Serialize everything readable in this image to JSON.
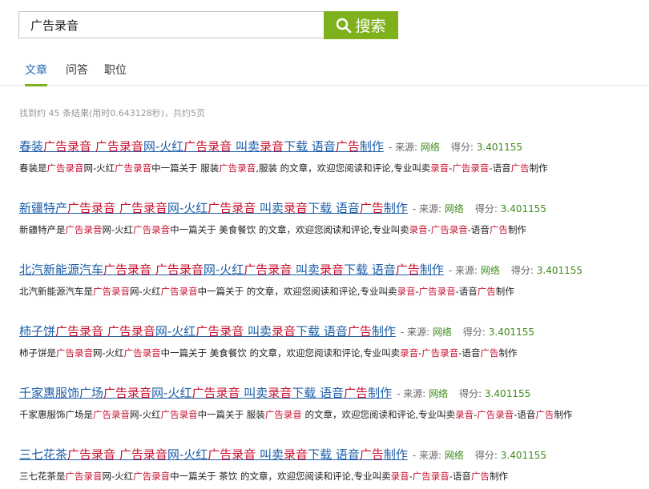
{
  "search": {
    "value": "广告录音",
    "button_label": "搜索"
  },
  "tabs": [
    {
      "label": "文章",
      "active": true
    },
    {
      "label": "问答",
      "active": false
    },
    {
      "label": "职位",
      "active": false
    }
  ],
  "stats": "找到约 45 条结果(用时0.643128秒)，共约5页",
  "colors": {
    "accent": "#7fb11d",
    "link": "#1d5ea8",
    "highlight": "#c8102e",
    "source": "#3c8c1a"
  },
  "labels": {
    "source": "来源:",
    "score": "得分:",
    "separator": "-"
  },
  "results": [
    {
      "title_prefix": "春装",
      "title_rest": "广告录音 广告录音网-火红广告录音 叫卖录音下载 语音广告制作",
      "source": "网络",
      "score": "3.401155",
      "snippet_name": "春装",
      "snippet_topic": "服装广告录音,服装",
      "snippet_body": "是广告录音网-火红广告录音中一篇关于 服装广告录音,服装 的文章，欢迎您阅读和评论,专业叫卖录音-广告录音-语音广告制作"
    },
    {
      "title_prefix": "新疆特产",
      "title_rest": "广告录音 广告录音网-火红广告录音 叫卖录音下载 语音广告制作",
      "source": "网络",
      "score": "3.401155",
      "snippet_name": "新疆特产",
      "snippet_body": "是广告录音网-火红广告录音中一篇关于 美食餐饮 的文章，欢迎您阅读和评论,专业叫卖录音-广告录音-语音广告制作"
    },
    {
      "title_prefix": "北汽新能源汽车",
      "title_rest": "广告录音 广告录音网-火红广告录音 叫卖录音下载 语音广告制作",
      "source": "网络",
      "score": "3.401155",
      "snippet_name": "北汽新能源汽车",
      "snippet_body": "是广告录音网-火红广告录音中一篇关于 的文章，欢迎您阅读和评论,专业叫卖录音-广告录音-语音广告制作"
    },
    {
      "title_prefix": "柿子饼",
      "title_rest": "广告录音 广告录音网-火红广告录音 叫卖录音下载 语音广告制作",
      "source": "网络",
      "score": "3.401155",
      "snippet_name": "柿子饼",
      "snippet_body": "是广告录音网-火红广告录音中一篇关于 美食餐饮 的文章，欢迎您阅读和评论,专业叫卖录音-广告录音-语音广告制作"
    },
    {
      "title_prefix": "千家惠服饰广场",
      "title_rest": "广告录音网-火红广告录音 叫卖录音下载 语音广告制作",
      "source": "网络",
      "score": "3.401155",
      "snippet_name": "千家惠服饰广场",
      "snippet_body": "是广告录音网-火红广告录音中一篇关于 服装广告录音 的文章，欢迎您阅读和评论,专业叫卖录音-广告录音-语音广告制作"
    },
    {
      "title_prefix": "三七花茶",
      "title_rest": "广告录音 广告录音网-火红广告录音 叫卖录音下载 语音广告制作",
      "source": "网络",
      "score": "3.401155",
      "snippet_name": "三七花茶",
      "snippet_body": "是广告录音网-火红广告录音中一篇关于 茶饮 的文章，欢迎您阅读和评论,专业叫卖录音-广告录音-语音广告制作"
    }
  ]
}
